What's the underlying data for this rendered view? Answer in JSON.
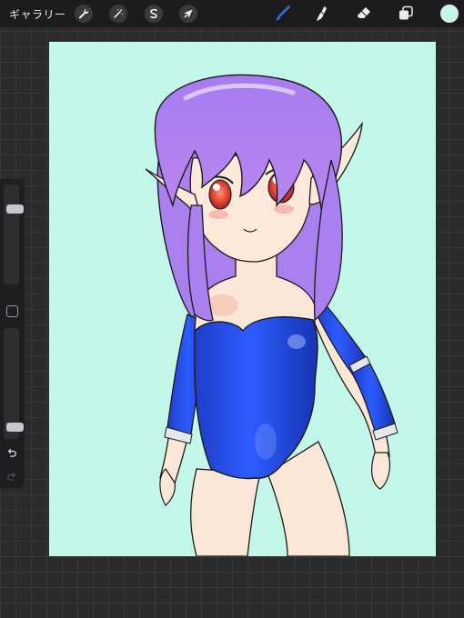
{
  "toolbar": {
    "gallery_label": "ギャラリー",
    "actions_icon": "wrench-icon",
    "adjustments_icon": "magic-wand-icon",
    "selection_icon": "selection-s-icon",
    "transform_icon": "arrow-cursor-icon",
    "brush_icon": "brush-icon",
    "smudge_icon": "smudge-icon",
    "eraser_icon": "eraser-icon",
    "layers_icon": "layers-icon",
    "current_color": "#c3f7ea",
    "brush_color": "#2f6fe8"
  },
  "canvas": {
    "background_color": "#c3f7ea"
  },
  "sidebar": {
    "brush_size_level": 0.78,
    "opacity_level": 0.07,
    "undo_icon": "undo-icon",
    "redo_icon": "redo-icon"
  }
}
